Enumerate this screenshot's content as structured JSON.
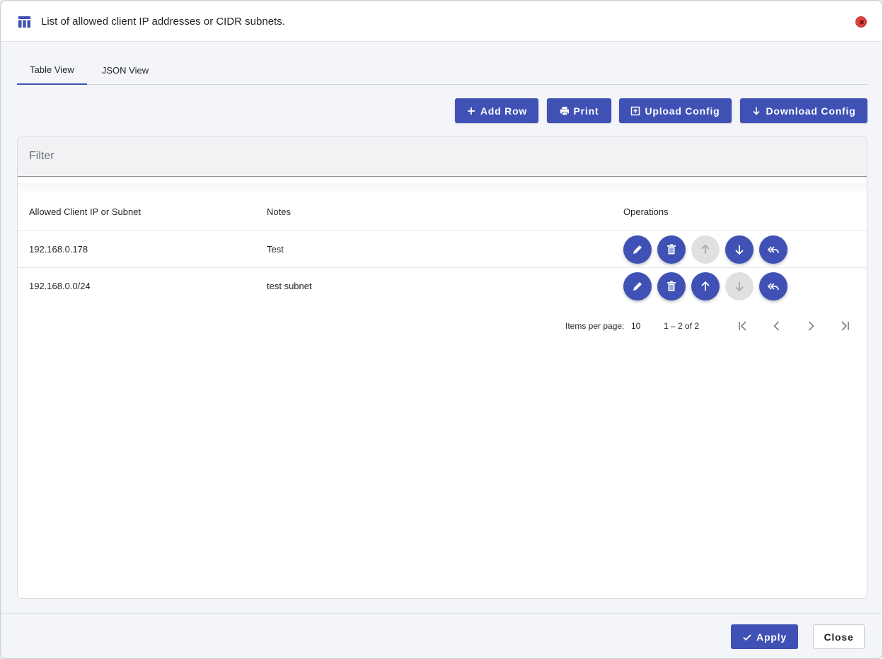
{
  "dialog": {
    "title": "List of allowed client IP addresses or CIDR subnets.",
    "title_icon": "table-icon",
    "close_icon": "close-icon"
  },
  "tabs": [
    {
      "label": "Table View",
      "active": true
    },
    {
      "label": "JSON View",
      "active": false
    }
  ],
  "toolbar": {
    "add_row": "Add Row",
    "print": "Print",
    "upload_config": "Upload Config",
    "download_config": "Download Config"
  },
  "filter": {
    "placeholder": "Filter",
    "value": ""
  },
  "table": {
    "columns": [
      "Allowed Client IP or Subnet",
      "Notes",
      "Operations"
    ],
    "rows": [
      {
        "ip": "192.168.0.178",
        "notes": "Test",
        "move_up_enabled": false,
        "move_down_enabled": true
      },
      {
        "ip": "192.168.0.0/24",
        "notes": "test subnet",
        "move_up_enabled": true,
        "move_down_enabled": false
      }
    ]
  },
  "paginator": {
    "items_per_page_label": "Items per page:",
    "page_size": "10",
    "range": "1 – 2 of 2"
  },
  "footer": {
    "apply": "Apply",
    "close": "Close"
  },
  "colors": {
    "primary": "#3f51b5",
    "disabled": "#e0e0e0",
    "close_dot": "#e0443e"
  }
}
